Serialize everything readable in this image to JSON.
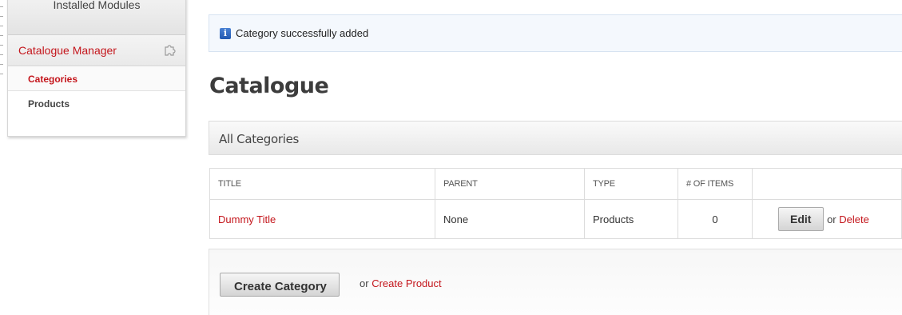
{
  "sidebar": {
    "installed_label": "Installed Modules",
    "manager_label": "Catalogue Manager",
    "manager_icon": "puzzle-icon",
    "items": [
      {
        "label": "Categories",
        "active": true
      },
      {
        "label": "Products",
        "active": false
      }
    ]
  },
  "notice": {
    "icon": "info-icon",
    "icon_glyph": "i",
    "message": "Category successfully added"
  },
  "page": {
    "title": "Catalogue"
  },
  "panel": {
    "title": "All Categories"
  },
  "table": {
    "headers": [
      "TITLE",
      "PARENT",
      "TYPE",
      "# OF ITEMS",
      ""
    ],
    "rows": [
      {
        "title": "Dummy Title",
        "parent": "None",
        "type": "Products",
        "items": "0",
        "edit_label": "Edit",
        "or": "or",
        "delete_label": "Delete"
      }
    ]
  },
  "footer": {
    "create_category_label": "Create Category",
    "or": "or",
    "create_product_label": "Create Product"
  },
  "colors": {
    "accent_red": "#c4161c",
    "info_blue": "#1f57b0",
    "notice_bg": "#f4f8fd"
  }
}
